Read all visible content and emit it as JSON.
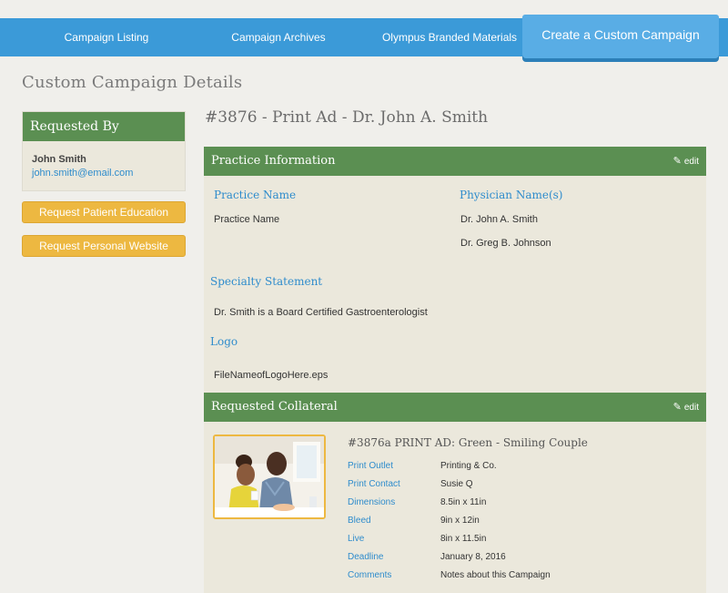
{
  "nav": {
    "items": [
      {
        "label": "Campaign Listing"
      },
      {
        "label": "Campaign Archives"
      },
      {
        "label": "Olympus Branded Materials"
      }
    ],
    "cta": "Create a Custom Campaign"
  },
  "page_title": "Custom Campaign Details",
  "sidebar": {
    "requested_by_heading": "Requested By",
    "name": "John Smith",
    "email": "john.smith@email.com",
    "buttons": [
      "Request Patient Education",
      "Request Personal Website"
    ]
  },
  "campaign_title": "#3876 - Print Ad - Dr. John A. Smith",
  "practice": {
    "heading": "Practice Information",
    "edit_label": "edit",
    "practice_name_label": "Practice Name",
    "practice_name_value": "Practice Name",
    "physician_label": "Physician Name(s)",
    "physicians": [
      "Dr. John A. Smith",
      "Dr. Greg B. Johnson"
    ],
    "specialty_label": "Specialty Statement",
    "specialty_value": "Dr. Smith is a Board Certified Gastroenterologist",
    "logo_label": "Logo",
    "logo_value": "FileNameofLogoHere.eps"
  },
  "collateral": {
    "heading": "Requested Collateral",
    "edit_label": "edit",
    "title": "#3876a PRINT AD: Green - Smiling Couple",
    "fields": [
      {
        "label": "Print Outlet",
        "value": "Printing & Co."
      },
      {
        "label": "Print Contact",
        "value": "Susie Q"
      },
      {
        "label": "Dimensions",
        "value": "8.5in x 11in"
      },
      {
        "label": "Bleed",
        "value": "9in x 12in"
      },
      {
        "label": "Live",
        "value": "8in x 11.5in"
      },
      {
        "label": "Deadline",
        "value": "January 8, 2016"
      },
      {
        "label": "Comments",
        "value": "Notes about this Campaign"
      }
    ]
  },
  "colors": {
    "nav_blue": "#3b9ad8",
    "cta_blue": "#59ade5",
    "panel_green": "#5b8f52",
    "button_yellow": "#edb841",
    "link_blue": "#2f8ccc"
  }
}
